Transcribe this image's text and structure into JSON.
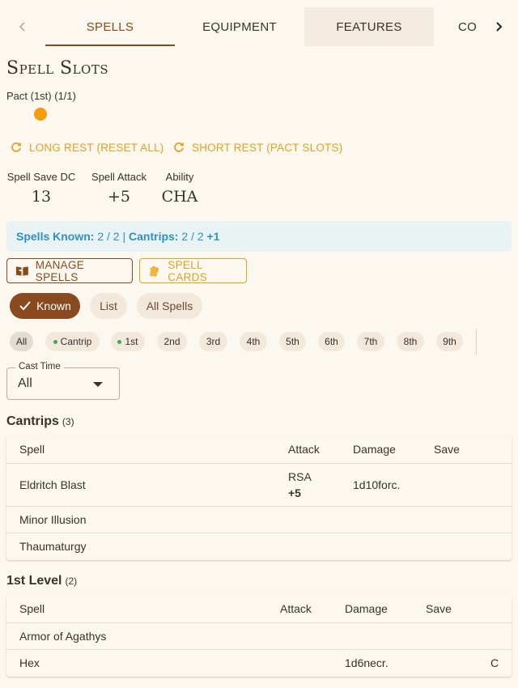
{
  "tabs": {
    "items": [
      "SPELLS",
      "EQUIPMENT",
      "FEATURES",
      "CO"
    ],
    "active": "SPELLS"
  },
  "spell_slots": {
    "title": "Spell Slots",
    "pact_label": "Pact (1st) (1/1)",
    "filled": 1,
    "total": 1
  },
  "rest": {
    "long": "LONG REST (RESET ALL)",
    "short": "SHORT REST (PACT SLOTS)"
  },
  "stats": [
    {
      "label": "Spell Save DC",
      "value": "13"
    },
    {
      "label": "Spell Attack",
      "value": "+5"
    },
    {
      "label": "Ability",
      "value": "CHA"
    }
  ],
  "known": {
    "known_label": "Spells Known:",
    "known_value": "2 / 2",
    "sep": "|",
    "cantrips_label": "Cantrips:",
    "cantrips_value": "2 / 2",
    "bonus": "+1"
  },
  "actions": {
    "manage": "MANAGE SPELLS",
    "cards": "SPELL CARDS"
  },
  "view_chips": [
    "Known",
    "List",
    "All Spells"
  ],
  "level_chips": [
    "All",
    "Cantrip",
    "1st",
    "2nd",
    "3rd",
    "4th",
    "5th",
    "6th",
    "7th",
    "8th",
    "9th"
  ],
  "cast_time": {
    "label": "Cast Time",
    "value": "All"
  },
  "cantrips": {
    "title": "Cantrips",
    "count": "(3)",
    "headers": [
      "Spell",
      "Attack",
      "Damage",
      "Save"
    ],
    "rows": [
      {
        "name": "Eldritch Blast",
        "attack_type": "RSA",
        "attack_bonus": "+5",
        "damage": "1d10forc.",
        "save": ""
      },
      {
        "name": "Minor Illusion",
        "attack_type": "",
        "attack_bonus": "",
        "damage": "",
        "save": ""
      },
      {
        "name": "Thaumaturgy",
        "attack_type": "",
        "attack_bonus": "",
        "damage": "",
        "save": ""
      }
    ]
  },
  "level1": {
    "title": "1st Level",
    "count": "(2)",
    "headers": [
      "Spell",
      "Attack",
      "Damage",
      "Save"
    ],
    "rows": [
      {
        "name": "Armor of Agathys",
        "attack": "",
        "damage": "",
        "save": "",
        "extra": ""
      },
      {
        "name": "Hex",
        "attack": "",
        "damage": "1d6necr.",
        "save": "",
        "extra": "C"
      }
    ]
  },
  "colors": {
    "accent": "#8a4a20",
    "gold": "#e6a21a",
    "slot": "#f59c0a",
    "info": "#2f8fc6",
    "cantrip_dot": "#2fb14b"
  }
}
